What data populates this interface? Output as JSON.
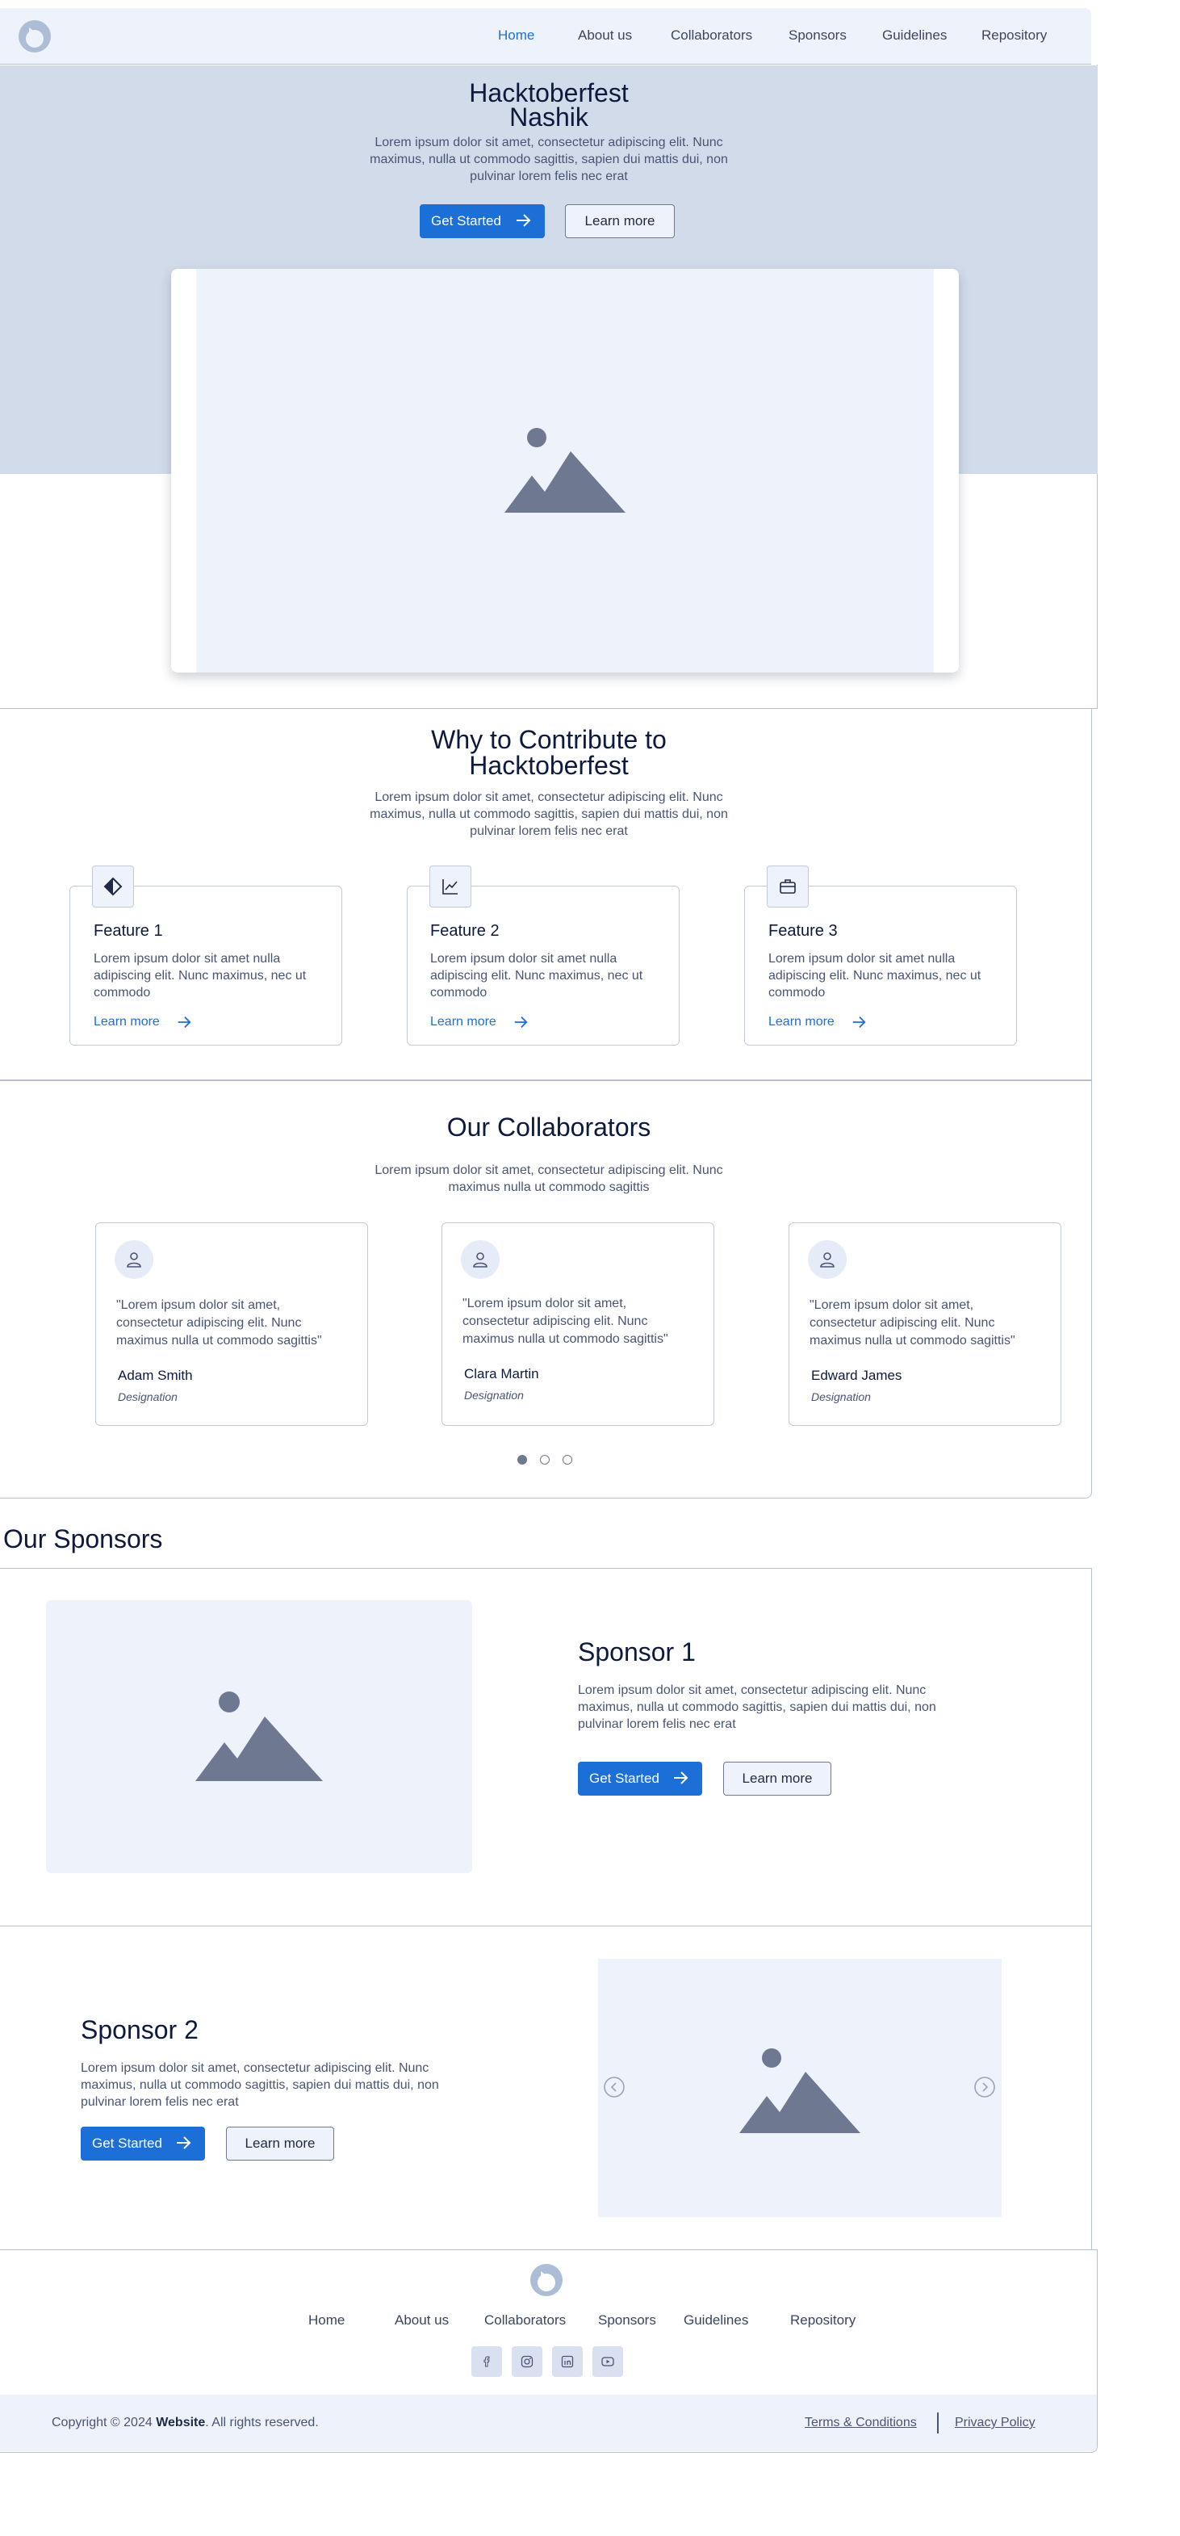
{
  "nav": {
    "logo": "logo-icon",
    "items": [
      {
        "label": "Home",
        "active": true
      },
      {
        "label": "About us"
      },
      {
        "label": "Collaborators"
      },
      {
        "label": "Sponsors"
      },
      {
        "label": "Guidelines"
      },
      {
        "label": "Repository"
      }
    ]
  },
  "hero": {
    "title_line1": "Hacktoberfest",
    "title_line2": "Nashik",
    "desc": "Lorem ipsum dolor sit amet, consectetur adipiscing elit. Nunc maximus, nulla ut commodo sagittis, sapien dui mattis dui, non pulvinar lorem felis nec erat",
    "primary_btn": "Get Started",
    "secondary_btn": "Learn more"
  },
  "why": {
    "title_line1": "Why to Contribute to",
    "title_line2": "Hacktoberfest",
    "desc": "Lorem ipsum dolor sit amet, consectetur adipiscing elit. Nunc maximus, nulla ut commodo sagittis, sapien dui mattis dui, non pulvinar lorem felis nec erat",
    "features": [
      {
        "icon": "contrast-icon",
        "title": "Feature 1",
        "desc": "Lorem ipsum dolor sit amet nulla adipiscing elit. Nunc maximus, nec ut commodo",
        "link": "Learn more"
      },
      {
        "icon": "chart-line-icon",
        "title": "Feature 2",
        "desc": "Lorem ipsum dolor sit amet nulla adipiscing elit. Nunc maximus, nec ut commodo",
        "link": "Learn more"
      },
      {
        "icon": "briefcase-icon",
        "title": "Feature 3",
        "desc": "Lorem ipsum dolor sit amet nulla adipiscing elit. Nunc maximus, nec ut commodo",
        "link": "Learn more"
      }
    ]
  },
  "collaborators": {
    "title": "Our Collaborators",
    "desc": "Lorem ipsum dolor sit amet, consectetur adipiscing elit. Nunc maximus nulla ut commodo sagittis",
    "people": [
      {
        "quote": "\"Lorem ipsum dolor sit amet, consectetur adipiscing elit. Nunc maximus nulla ut commodo sagittis\"",
        "name": "Adam Smith",
        "role": "Designation"
      },
      {
        "quote": "\"Lorem ipsum dolor sit amet, consectetur adipiscing elit. Nunc maximus nulla ut commodo sagittis\"",
        "name": "Clara Martin",
        "role": "Designation"
      },
      {
        "quote": "\"Lorem ipsum dolor sit amet, consectetur adipiscing elit. Nunc maximus nulla ut commodo sagittis\"",
        "name": "Edward James",
        "role": "Designation"
      }
    ]
  },
  "sponsors": {
    "heading": "Our Sponsors",
    "list": [
      {
        "title": "Sponsor 1",
        "desc": "Lorem ipsum dolor sit amet, consectetur adipiscing elit. Nunc maximus, nulla ut commodo sagittis, sapien dui mattis dui, non pulvinar lorem felis nec erat",
        "primary_btn": "Get Started",
        "secondary_btn": "Learn more"
      },
      {
        "title": "Sponsor 2",
        "desc": "Lorem ipsum dolor sit amet, consectetur adipiscing elit. Nunc maximus, nulla ut commodo sagittis, sapien dui mattis dui, non pulvinar lorem felis nec erat",
        "primary_btn": "Get Started",
        "secondary_btn": "Learn more"
      }
    ]
  },
  "footer": {
    "links": [
      "Home",
      "About us",
      "Collaborators",
      "Sponsors",
      "Guidelines",
      "Repository"
    ],
    "social": [
      "facebook-icon",
      "instagram-icon",
      "linkedin-icon",
      "youtube-icon"
    ],
    "copyright_prefix": "Copyright © 2024 ",
    "copyright_brand": "Website",
    "copyright_suffix": ". All rights reserved.",
    "terms": "Terms & Conditions",
    "privacy": "Privacy Policy"
  },
  "colors": {
    "accent": "#1d6fd8",
    "hero_bg": "#d2dbe9",
    "placeholder_bg": "#eef3fb",
    "placeholder_icon": "#6f7891",
    "text_dark": "#0e1a3d"
  }
}
